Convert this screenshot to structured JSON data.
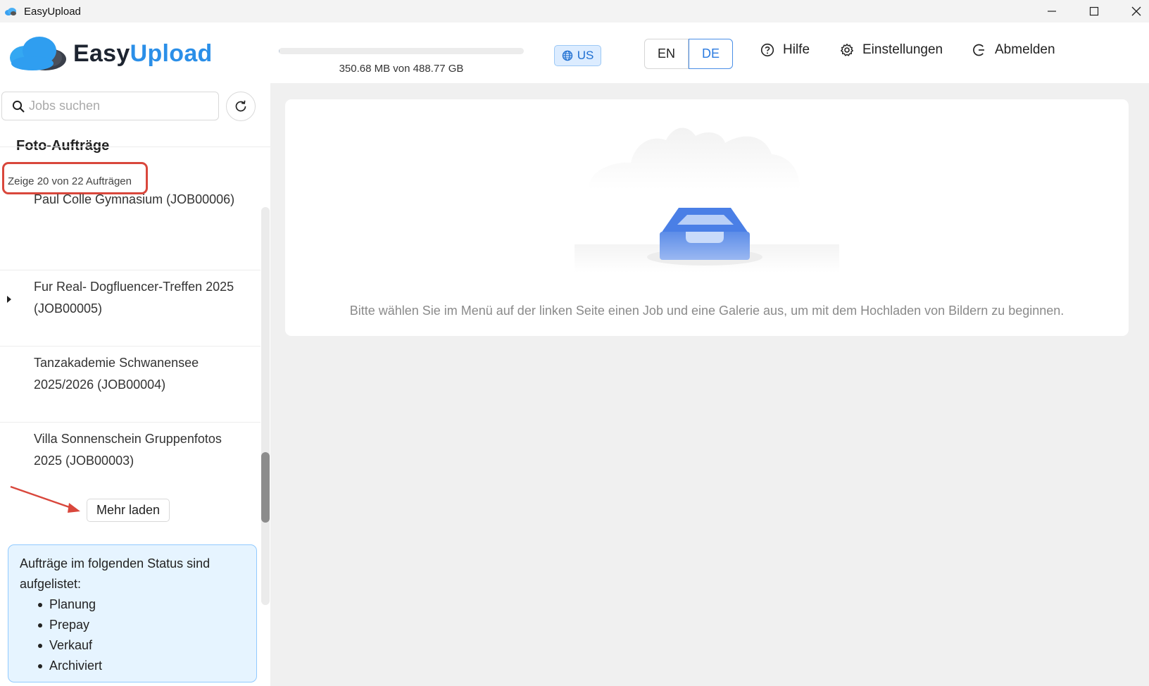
{
  "window": {
    "title": "EasyUpload",
    "controls": [
      "minimize",
      "maximize",
      "close"
    ]
  },
  "header": {
    "logo_part1": "Easy",
    "logo_part2": "Upload",
    "storage": {
      "used_text": "350.68 MB von 488.77 GB",
      "fraction_used": 0.0007
    },
    "region": "US",
    "languages": [
      {
        "label": "EN",
        "active": false
      },
      {
        "label": "DE",
        "active": true
      }
    ],
    "help_label": "Hilfe",
    "settings_label": "Einstellungen",
    "logout_label": "Abmelden"
  },
  "sidebar": {
    "search_placeholder": "Jobs suchen",
    "section_title": "Foto-Aufträge",
    "count_text": "Zeige 20 von 22 Aufträgen",
    "jobs": [
      {
        "name": "Paul Colle Gymnasium (JOB00006)",
        "expandable": false
      },
      {
        "name": "Fur Real- Dogfluencer-Treffen 2025 (JOB00005)",
        "expandable": true
      },
      {
        "name": "Tanzakademie Schwanensee 2025/2026 (JOB00004)",
        "expandable": false
      },
      {
        "name": "Villa Sonnenschein Gruppenfotos 2025 (JOB00003)",
        "expandable": false
      }
    ],
    "load_more_label": "Mehr laden",
    "info": {
      "title": "Aufträge im folgenden Status sind aufgelistet:",
      "statuses": [
        "Planung",
        "Prepay",
        "Verkauf",
        "Archiviert"
      ]
    }
  },
  "main": {
    "empty_message": "Bitte wählen Sie im Menü auf der linken Seite einen Job und eine Galerie aus, um mit dem Hochladen von Bildern zu beginnen."
  },
  "colors": {
    "brand_blue": "#2b8fe8",
    "highlight_red": "#d9473c",
    "info_bg": "#e6f4ff"
  }
}
